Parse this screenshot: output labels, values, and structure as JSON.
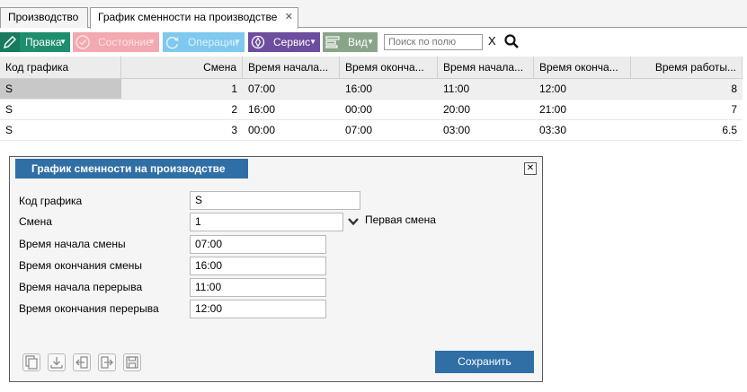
{
  "tabs": [
    {
      "label": "Производство"
    },
    {
      "label": "График сменности на производстве",
      "close": "✕"
    }
  ],
  "toolbar": {
    "edit_label": "Правка",
    "state_label": "Состояние",
    "ops_label": "Операции",
    "service_label": "Сервис",
    "view_label": "Вид",
    "search_placeholder": "Поиск по полю",
    "clear_label": "X",
    "colors": {
      "edit": "#1f8e6e",
      "state": "#f3a9b0",
      "ops": "#7fc8ee",
      "service": "#6d4d9e",
      "view": "#8aa48a"
    }
  },
  "grid": {
    "columns": [
      "Код графика",
      "Смена",
      "Время начала...",
      "Время оконча...",
      "Время начала...",
      "Время оконча...",
      "Время работы..."
    ],
    "rows": [
      [
        "S",
        "1",
        "07:00",
        "16:00",
        "11:00",
        "12:00",
        "8"
      ],
      [
        "S",
        "2",
        "16:00",
        "00:00",
        "20:00",
        "21:00",
        "7"
      ],
      [
        "S",
        "3",
        "00:00",
        "07:00",
        "03:00",
        "03:30",
        "6.5"
      ]
    ]
  },
  "dialog": {
    "title": "График сменности на производстве",
    "close": "✕",
    "fields": {
      "code_label": "Код графика",
      "code_value": "S",
      "shift_label": "Смена",
      "shift_value": "1",
      "shift_hint": "Первая смена",
      "start_label": "Время начала смены",
      "start_value": "07:00",
      "end_label": "Время окончания смены",
      "end_value": "16:00",
      "break_start_label": "Время начала перерыва",
      "break_start_value": "11:00",
      "break_end_label": "Время окончания перерыва",
      "break_end_value": "12:00"
    },
    "save_label": "Сохранить",
    "accent": "#2f6fa5"
  }
}
